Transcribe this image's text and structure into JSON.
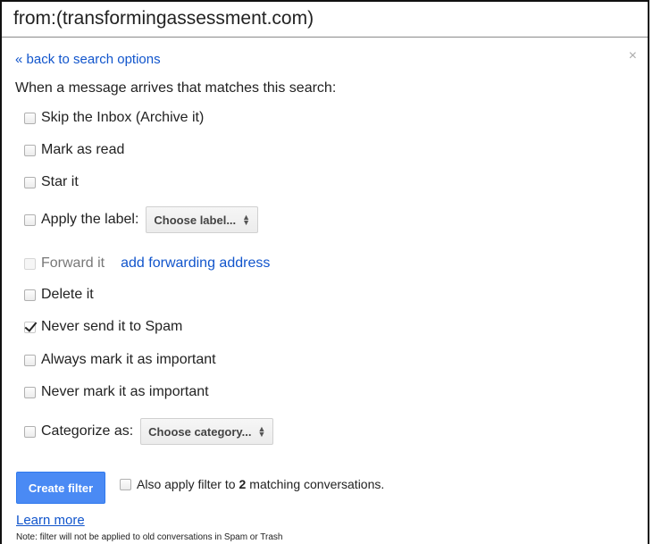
{
  "query": "from:(transformingassessment.com)",
  "back_link": "« back to search options",
  "close_glyph": "×",
  "intro": "When a message arrives that matches this search:",
  "options": {
    "skip_inbox": {
      "label": "Skip the Inbox (Archive it)",
      "checked": false
    },
    "mark_read": {
      "label": "Mark as read",
      "checked": false
    },
    "star": {
      "label": "Star it",
      "checked": false
    },
    "apply_label": {
      "label": "Apply the label:",
      "checked": false,
      "select": "Choose label..."
    },
    "forward": {
      "label": "Forward it",
      "checked": false,
      "disabled": true,
      "link": "add forwarding address"
    },
    "delete": {
      "label": "Delete it",
      "checked": false
    },
    "never_spam": {
      "label": "Never send it to Spam",
      "checked": true
    },
    "always_important": {
      "label": "Always mark it as important",
      "checked": false
    },
    "never_important": {
      "label": "Never mark it as important",
      "checked": false
    },
    "categorize": {
      "label": "Categorize as:",
      "checked": false,
      "select": "Choose category..."
    }
  },
  "create_button": "Create filter",
  "also_apply": {
    "prefix": "Also apply filter to",
    "count": "2",
    "suffix": "matching conversations."
  },
  "learn_more": "Learn more",
  "note": "Note: filter will not be applied to old conversations in Spam or Trash",
  "colors": {
    "link": "#1155cc",
    "primary_button": "#4a8af4"
  }
}
